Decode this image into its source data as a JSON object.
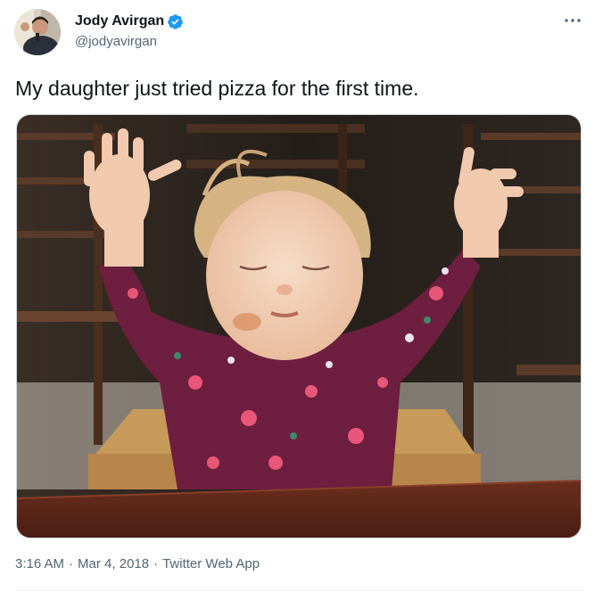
{
  "author": {
    "display_name": "Jody Avirgan",
    "handle": "@jodyavirgan",
    "verified": true
  },
  "tweet": {
    "text": "My daughter just tried pizza for the first time."
  },
  "meta": {
    "time": "3:16 AM",
    "date": "Mar 4, 2018",
    "separator": "·",
    "source": "Twitter Web App"
  },
  "icons": {
    "verified": "verified-badge-icon",
    "more": "more-options-icon"
  },
  "colors": {
    "verified_blue": "#1d9bf0",
    "secondary_text": "#536471",
    "primary_text": "#0f1419",
    "divider": "#eff3f4"
  }
}
